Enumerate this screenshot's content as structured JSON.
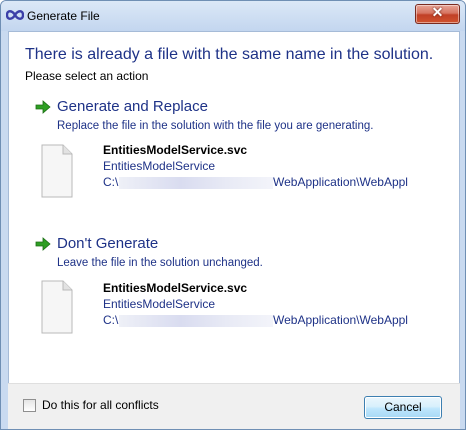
{
  "window": {
    "title": "Generate File",
    "close_glyph": "✕"
  },
  "header": {
    "heading": "There is already a file with the same name in the solution.",
    "subheading": "Please select an action"
  },
  "options": [
    {
      "title": "Generate and Replace",
      "description": "Replace the file in the solution with the file you are generating.",
      "file": {
        "name": "EntitiesModelService.svc",
        "project": "EntitiesModelService",
        "path_start": "C:\\",
        "path_end": "WebApplication\\WebAppl"
      }
    },
    {
      "title": "Don't Generate",
      "description": "Leave the file in the solution unchanged.",
      "file": {
        "name": "EntitiesModelService.svc",
        "project": "EntitiesModelService",
        "path_start": "C:\\",
        "path_end": "WebApplication\\WebAppl"
      }
    }
  ],
  "footer": {
    "checkbox_label": "Do this for all conflicts",
    "checkbox_checked": false,
    "cancel_label": "Cancel"
  },
  "icons": {
    "app": "infinity-icon",
    "option_arrow": "green-arrow-icon",
    "file": "blank-document-icon"
  },
  "colors": {
    "heading_text": "#1e3287",
    "arrow_green": "#2e9e23",
    "close_button": "#c14026"
  }
}
